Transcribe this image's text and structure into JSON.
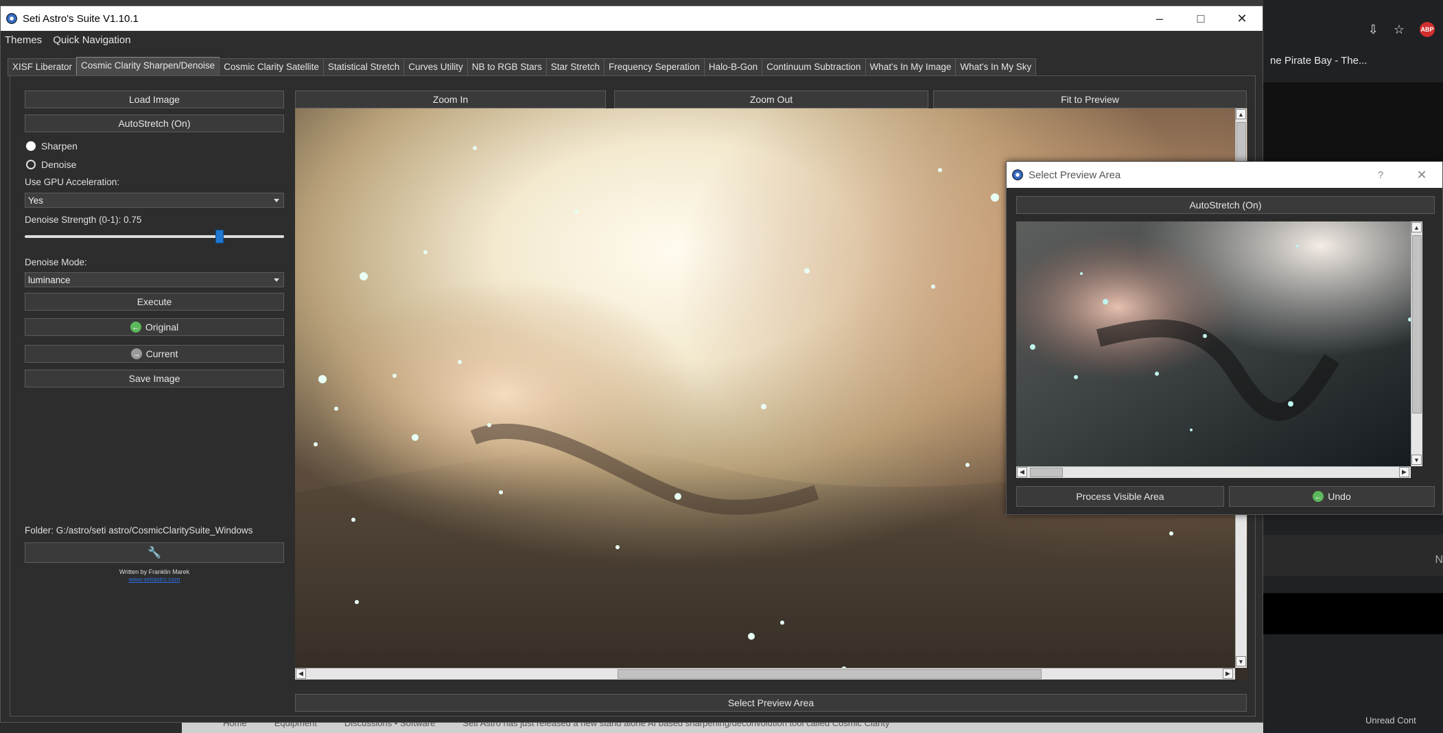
{
  "background_browser": {
    "tab_text": "ne Pirate Bay - The...",
    "adblock_badge": "ABP",
    "side_letter": "N",
    "bottom_crumbs": [
      "Home",
      "Equipment",
      "Discussions • Software",
      "Seti Astro has just released a new stand alone AI based sharpening/deconvolution tool called Cosmic Clarity"
    ],
    "unread_label": "Unread Cont"
  },
  "window": {
    "title": "Seti Astro's Suite V1.10.1"
  },
  "menu": [
    "Themes",
    "Quick Navigation"
  ],
  "tabs": [
    {
      "label": "XISF Liberator",
      "active": false
    },
    {
      "label": "Cosmic Clarity Sharpen/Denoise",
      "active": true
    },
    {
      "label": "Cosmic Clarity Satellite",
      "active": false
    },
    {
      "label": "Statistical Stretch",
      "active": false
    },
    {
      "label": "Curves Utility",
      "active": false
    },
    {
      "label": "NB to RGB Stars",
      "active": false
    },
    {
      "label": "Star Stretch",
      "active": false
    },
    {
      "label": "Frequency Seperation",
      "active": false
    },
    {
      "label": "Halo-B-Gon",
      "active": false
    },
    {
      "label": "Continuum Subtraction",
      "active": false
    },
    {
      "label": "What's In My Image",
      "active": false
    },
    {
      "label": "What's In My Sky",
      "active": false
    }
  ],
  "left_panel": {
    "load_image": "Load Image",
    "autostretch": "AutoStretch (On)",
    "mode_sharpen": "Sharpen",
    "mode_denoise": "Denoise",
    "selected_mode": "Sharpen",
    "gpu_label": "Use GPU Acceleration:",
    "gpu_value": "Yes",
    "denoise_strength_label": "Denoise Strength (0-1): 0.75",
    "denoise_strength_value": 0.75,
    "denoise_mode_label": "Denoise Mode:",
    "denoise_mode_value": "luminance",
    "execute": "Execute",
    "original": "Original",
    "current": "Current",
    "save_image": "Save Image",
    "folder": "Folder: G:/astro/seti astro/CosmicClaritySuite_Windows",
    "credit": "Written by Franklin Marek",
    "website": "www.setiastro.com"
  },
  "viewer": {
    "zoom_in": "Zoom In",
    "zoom_out": "Zoom Out",
    "fit_to_preview": "Fit to Preview",
    "select_preview_area": "Select Preview Area"
  },
  "dialog": {
    "title": "Select Preview Area",
    "help": "?",
    "autostretch": "AutoStretch (On)",
    "process_visible_area": "Process Visible Area",
    "undo": "Undo"
  },
  "colors": {
    "accent": "#1f77d0",
    "window_bg": "#2d2d2d",
    "button_bg": "#3a3a3a",
    "green_arrow": "#5cb85c"
  }
}
